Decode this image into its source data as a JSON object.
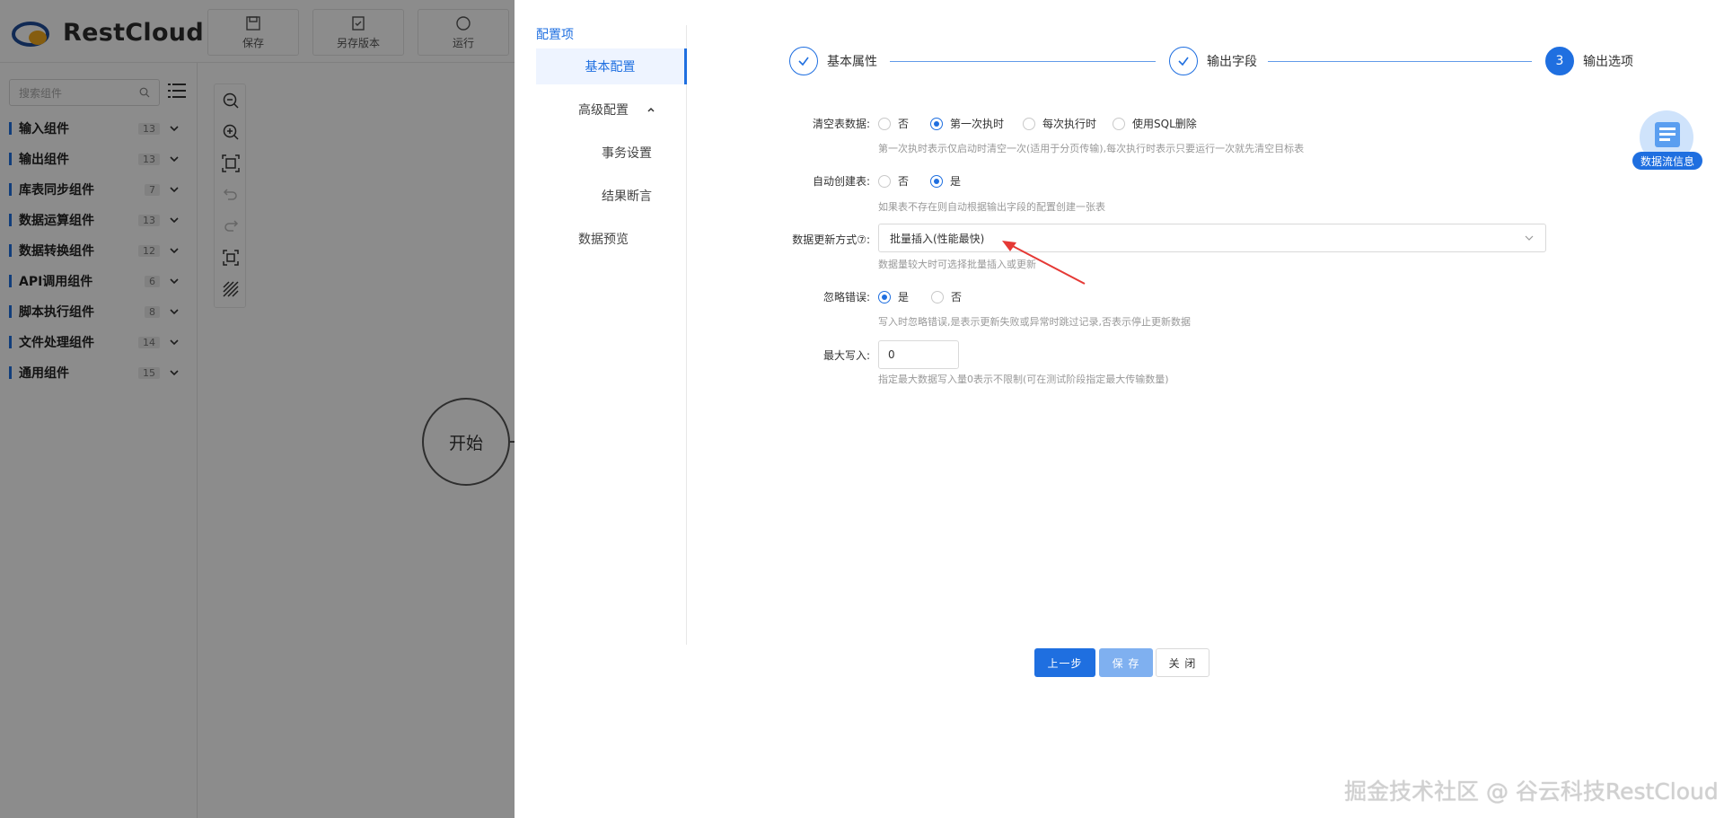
{
  "app": {
    "logo_text": "RestCloud",
    "toolbar": [
      {
        "label": "保存",
        "icon": "save-icon"
      },
      {
        "label": "另存版本",
        "icon": "save-version-icon"
      },
      {
        "label": "运行",
        "icon": "run-icon"
      }
    ]
  },
  "sidebar": {
    "search_placeholder": "搜索组件",
    "groups": [
      {
        "label": "输入组件",
        "count": "13"
      },
      {
        "label": "输出组件",
        "count": "13"
      },
      {
        "label": "库表同步组件",
        "count": "7"
      },
      {
        "label": "数据运算组件",
        "count": "13"
      },
      {
        "label": "数据转换组件",
        "count": "12"
      },
      {
        "label": "API调用组件",
        "count": "6"
      },
      {
        "label": "脚本执行组件",
        "count": "8"
      },
      {
        "label": "文件处理组件",
        "count": "14"
      },
      {
        "label": "通用组件",
        "count": "15"
      }
    ]
  },
  "canvas": {
    "start_node_label": "开始"
  },
  "drawer": {
    "nav_title": "配置项",
    "nav": {
      "basic": "基本配置",
      "advanced": "高级配置",
      "transaction": "事务设置",
      "assertion": "结果断言",
      "preview": "数据预览"
    },
    "steps": [
      {
        "label": "基本属性",
        "state": "done"
      },
      {
        "label": "输出字段",
        "state": "done"
      },
      {
        "label": "输出选项",
        "state": "current",
        "number": "3"
      }
    ],
    "form": {
      "clear_table": {
        "label": "清空表数据:",
        "options": [
          "否",
          "第一次执时",
          "每次执行时",
          "使用SQL删除"
        ],
        "selected": "第一次执时",
        "help": "第一次执时表示仅启动时清空一次(适用于分页传输),每次执行时表示只要运行一次就先清空目标表"
      },
      "auto_create": {
        "label": "自动创建表:",
        "options": [
          "否",
          "是"
        ],
        "selected": "是",
        "help": "如果表不存在则自动根据输出字段的配置创建一张表"
      },
      "update_mode": {
        "label": "数据更新方式⑦:",
        "value": "批量插入(性能最快)",
        "help": "数据量较大时可选择批量插入或更新"
      },
      "ignore_error": {
        "label": "忽略错误:",
        "options": [
          "是",
          "否"
        ],
        "selected": "是",
        "help": "写入时忽略错误,是表示更新失败或异常时跳过记录,否表示停止更新数据"
      },
      "max_write": {
        "label": "最大写入:",
        "value": "0",
        "help": "指定最大数据写入量0表示不限制(可在测试阶段指定最大传输数量)"
      }
    },
    "buttons": {
      "prev": "上一步",
      "save": "保 存",
      "close": "关 闭"
    },
    "flow_info_label": "数据流信息"
  },
  "watermark": "掘金技术社区 @ 谷云科技RestCloud",
  "colors": {
    "accent": "#1f6fe0",
    "annotation_arrow": "#e53935"
  }
}
